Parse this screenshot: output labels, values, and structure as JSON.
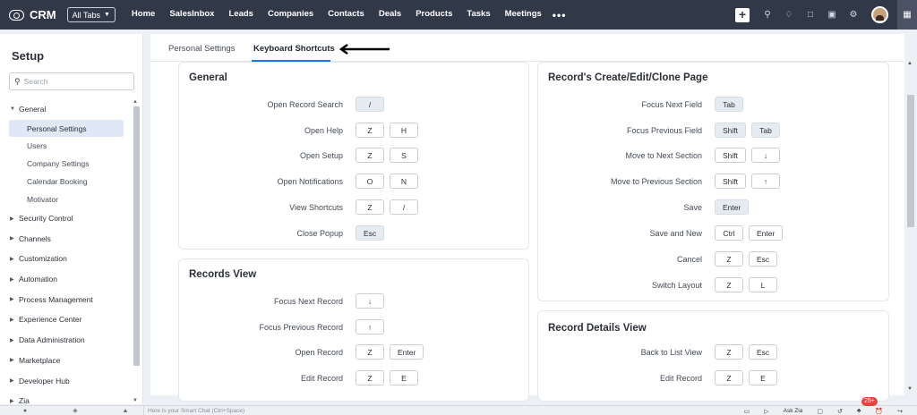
{
  "topbar": {
    "brand": "CRM",
    "all_tabs_label": "All Tabs",
    "nav": [
      "Home",
      "SalesInbox",
      "Leads",
      "Companies",
      "Contacts",
      "Deals",
      "Products",
      "Tasks",
      "Meetings"
    ],
    "more": "•••",
    "icons": [
      "plus-icon",
      "search-icon",
      "bell-icon",
      "calendar-icon",
      "marketplace-icon",
      "gear-icon",
      "avatar",
      "apps-grid-icon"
    ]
  },
  "sidebar": {
    "title": "Setup",
    "search_placeholder": "Search",
    "groups": [
      {
        "label": "General",
        "expanded": true,
        "items": [
          "Personal Settings",
          "Users",
          "Company Settings",
          "Calendar Booking",
          "Motivator"
        ],
        "active_item": "Personal Settings"
      },
      {
        "label": "Security Control"
      },
      {
        "label": "Channels"
      },
      {
        "label": "Customization"
      },
      {
        "label": "Automation"
      },
      {
        "label": "Process Management"
      },
      {
        "label": "Experience Center"
      },
      {
        "label": "Data Administration"
      },
      {
        "label": "Marketplace"
      },
      {
        "label": "Developer Hub"
      },
      {
        "label": "Zia"
      }
    ]
  },
  "tabs": [
    {
      "label": "Personal Settings",
      "active": false
    },
    {
      "label": "Keyboard Shortcuts",
      "active": true
    }
  ],
  "cards": {
    "general": {
      "title": "General",
      "rows": [
        {
          "label": "Open Record Search",
          "keys": [
            "/"
          ]
        },
        {
          "label": "Open Help",
          "keys": [
            "Z",
            "H"
          ]
        },
        {
          "label": "Open Setup",
          "keys": [
            "Z",
            "S"
          ]
        },
        {
          "label": "Open Notifications",
          "keys": [
            "O",
            "N"
          ]
        },
        {
          "label": "View Shortcuts",
          "keys": [
            "Z",
            "/"
          ]
        },
        {
          "label": "Close Popup",
          "keys": [
            "Esc"
          ]
        }
      ]
    },
    "records_view": {
      "title": "Records View",
      "rows": [
        {
          "label": "Focus Next Record",
          "keys": [
            "↓"
          ]
        },
        {
          "label": "Focus Previous Record",
          "keys": [
            "↑"
          ]
        },
        {
          "label": "Open Record",
          "keys": [
            "Z",
            "Enter"
          ]
        },
        {
          "label": "Edit Record",
          "keys": [
            "Z",
            "E"
          ]
        }
      ]
    },
    "create_page": {
      "title": "Record's Create/Edit/Clone Page",
      "rows": [
        {
          "label": "Focus Next Field",
          "keys": [
            "Tab"
          ]
        },
        {
          "label": "Focus Previous Field",
          "keys": [
            "Shift",
            "Tab"
          ]
        },
        {
          "label": "Move to Next Section",
          "keys": [
            "Shift",
            "↓"
          ]
        },
        {
          "label": "Move to Previous Section",
          "keys": [
            "Shift",
            "↑"
          ]
        },
        {
          "label": "Save",
          "keys": [
            "Enter"
          ]
        },
        {
          "label": "Save and New",
          "keys": [
            "Ctrl",
            "Enter"
          ]
        },
        {
          "label": "Cancel",
          "keys": [
            "Z",
            "Esc"
          ]
        },
        {
          "label": "Switch Layout",
          "keys": [
            "Z",
            "L"
          ]
        }
      ]
    },
    "details_view": {
      "title": "Record Details View",
      "rows": [
        {
          "label": "Back to List View",
          "keys": [
            "Z",
            "Esc"
          ]
        },
        {
          "label": "Edit Record",
          "keys": [
            "Z",
            "E"
          ]
        }
      ]
    }
  },
  "bottombar": {
    "chat_placeholder": "Here is your Smart Chat (Ctrl+Space)",
    "ask_zia": "Ask Zia",
    "notification_badge": "25+"
  },
  "colors": {
    "topbar_bg": "#313949",
    "accent": "#1a73e8",
    "active_item_bg": "#dfe8f5",
    "badge": "#e2453c"
  }
}
